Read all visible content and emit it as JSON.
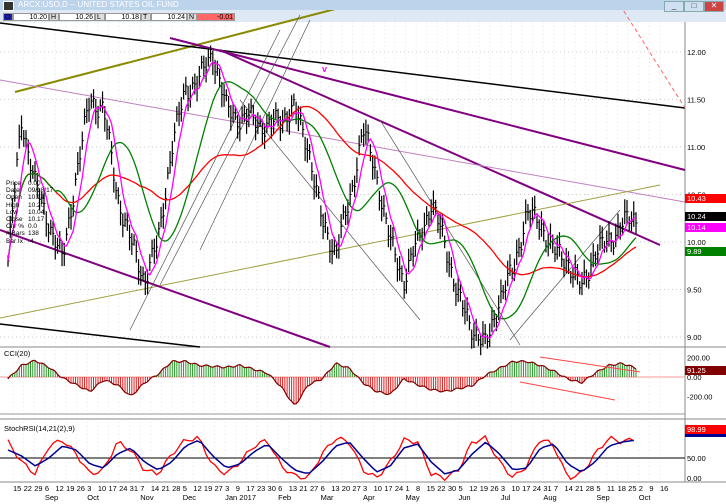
{
  "window": {
    "title": "ARCX:USO,D -- UNITED STATES OIL FUND",
    "buttons": [
      "_",
      "□",
      "✕"
    ]
  },
  "ohlc_bar": [
    {
      "k": "O",
      "v": "10.20"
    },
    {
      "k": "H",
      "v": "10.26"
    },
    {
      "k": "L",
      "v": "10.18"
    },
    {
      "k": "T",
      "v": "10.24"
    },
    {
      "k": "N",
      "v": "-0.01"
    }
  ],
  "info_panel": [
    {
      "k": "Price",
      "v": "0.00"
    },
    {
      "k": "Date",
      "v": "09/18/17"
    },
    {
      "k": "Open",
      "v": "10.14"
    },
    {
      "k": "High",
      "v": "10.20"
    },
    {
      "k": "Low",
      "v": "10.04"
    },
    {
      "k": "Close",
      "v": "10.17"
    },
    {
      "k": "Chr %",
      "v": "0.0"
    },
    {
      "k": "# Bars",
      "v": "138"
    },
    {
      "k": "Bar Ix",
      "v": "-4"
    }
  ],
  "annotation": "v",
  "colors": {
    "up": "#008000",
    "down": "#cc0000",
    "ma_long": "#ff0000",
    "ma_mid": "#008000",
    "ma_short": "#ff00ff",
    "trend": "#800080"
  },
  "chart_data": [
    {
      "type": "ohlc",
      "title": "ARCX:USO,D",
      "ylim": [
        8.9,
        12.3
      ],
      "price_ticks": [
        "12.00",
        "11.50",
        "11.00",
        "10.50",
        "10.00",
        "9.50",
        "9.00"
      ],
      "closes": [
        9.8,
        11.3,
        10.6,
        10.2,
        9.8,
        10.7,
        11.5,
        11.4,
        10.5,
        10.0,
        9.6,
        10.0,
        11.0,
        11.6,
        11.7,
        12.0,
        11.4,
        11.3,
        11.3,
        11.2,
        11.3,
        11.4,
        11.0,
        10.2,
        9.9,
        10.4,
        11.2,
        10.7,
        10.0,
        9.6,
        10.0,
        10.4,
        10.0,
        9.4,
        9.1,
        8.9,
        9.4,
        9.7,
        10.3,
        10.2,
        9.9,
        9.8,
        9.5,
        9.9,
        10.0,
        10.2,
        10.24
      ],
      "price_tags": [
        {
          "label": "10.43",
          "color": "#ff0000"
        },
        {
          "label": "10.24",
          "color": "#000000"
        },
        {
          "label": "10.14",
          "color": "#ff00ff"
        },
        {
          "label": "9.89",
          "color": "#008000"
        }
      ],
      "x_ticks": [
        "15",
        "22",
        "29",
        "6",
        "12",
        "19",
        "26",
        "3",
        "10",
        "17",
        "24",
        "31",
        "7",
        "14",
        "21",
        "28",
        "5",
        "12",
        "19",
        "27",
        "3",
        "9",
        "17",
        "23",
        "30",
        "6",
        "13",
        "21",
        "27",
        "6",
        "13",
        "20",
        "27",
        "3",
        "10",
        "17",
        "24",
        "1",
        "8",
        "15",
        "22",
        "30",
        "5",
        "12",
        "19",
        "26",
        "3",
        "10",
        "17",
        "24",
        "31",
        "7",
        "14",
        "21",
        "28",
        "5",
        "11",
        "18",
        "25",
        "2",
        "9",
        "16"
      ],
      "month_labels": [
        "Sep",
        "Oct",
        "Nov",
        "Dec",
        "Jan 2017",
        "Feb",
        "Mar",
        "Apr",
        "May",
        "Jun",
        "Jul",
        "Aug",
        "Sep",
        "Oct"
      ]
    },
    {
      "type": "bar",
      "title": "CCI(20)",
      "ylim": [
        -300,
        250
      ],
      "ticks": [
        "200.00",
        "0.00",
        "-200.00"
      ],
      "last": "91.25",
      "values": [
        -20,
        120,
        170,
        100,
        -10,
        -80,
        -150,
        -30,
        -80,
        -200,
        -60,
        30,
        160,
        160,
        120,
        110,
        100,
        120,
        80,
        40,
        -100,
        -300,
        -80,
        -20,
        140,
        90,
        -60,
        -150,
        -180,
        -20,
        -80,
        -130,
        -150,
        -120,
        -90,
        20,
        90,
        160,
        160,
        120,
        60,
        -20,
        -60,
        40,
        120,
        140,
        91
      ]
    },
    {
      "type": "line",
      "title": "StochRSI(14,21(2),9)",
      "ylim": [
        0,
        100
      ],
      "ticks": [
        "50.00",
        "0.00"
      ],
      "last": "98.99",
      "values": [
        90,
        40,
        10,
        80,
        95,
        60,
        10,
        20,
        90,
        70,
        20,
        10,
        60,
        95,
        100,
        30,
        10,
        40,
        80,
        95,
        30,
        5,
        0,
        60,
        100,
        90,
        20,
        0,
        40,
        95,
        90,
        10,
        0,
        20,
        90,
        100,
        40,
        0,
        30,
        100,
        80,
        0,
        10,
        60,
        100,
        90,
        99
      ],
      "signal": [
        70,
        55,
        30,
        50,
        80,
        70,
        35,
        25,
        60,
        75,
        40,
        20,
        40,
        80,
        95,
        55,
        25,
        35,
        65,
        85,
        50,
        20,
        10,
        40,
        80,
        90,
        50,
        15,
        30,
        75,
        85,
        40,
        10,
        20,
        60,
        90,
        60,
        20,
        25,
        75,
        85,
        35,
        15,
        40,
        80,
        90,
        95
      ]
    }
  ]
}
